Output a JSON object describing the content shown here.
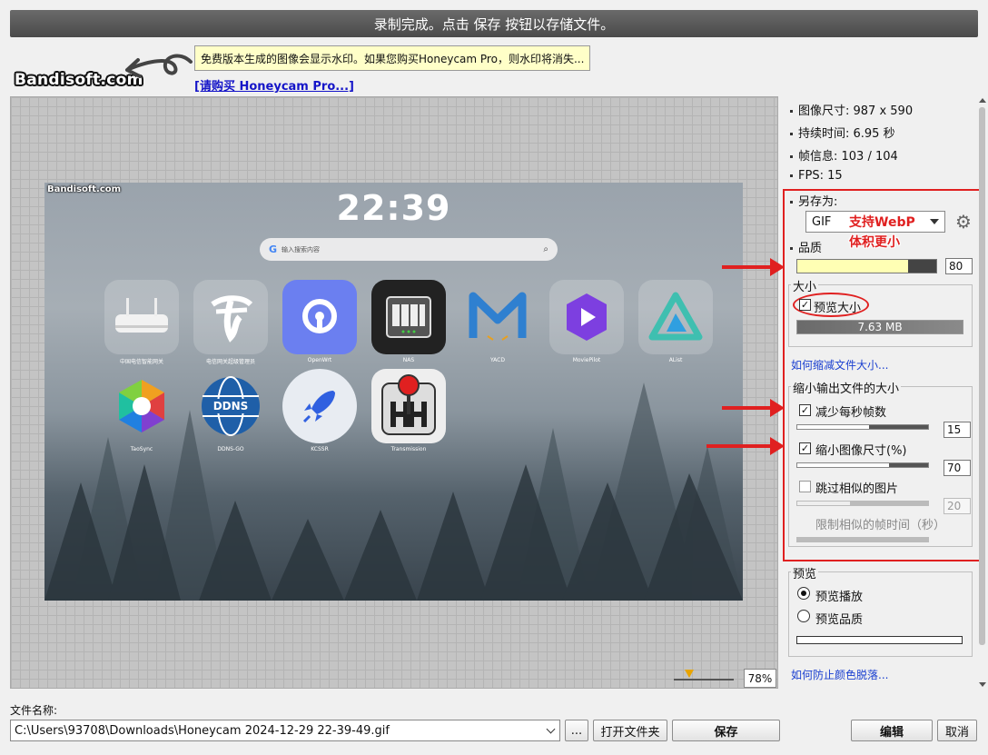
{
  "title_bar": "录制完成。点击 保存 按钮以存储文件。",
  "brand": "Bandisoft.com",
  "watermark_notice": "免费版本生成的图像会显示水印。如果您购买Honeycam Pro，则水印将消失...",
  "buy_link": "[请购买 Honeycam Pro...]",
  "preview": {
    "watermark": "Bandisoft.com",
    "clock": "22:39",
    "search_placeholder": "输入搜索内容",
    "apps": [
      {
        "label": "中国电信智能网关"
      },
      {
        "label": "电信网关超级管理员"
      },
      {
        "label": "OpenWrt"
      },
      {
        "label": "NAS"
      },
      {
        "label": "YACD"
      },
      {
        "label": "MoviePilot"
      },
      {
        "label": "AList"
      },
      {
        "label": "TaoSync"
      },
      {
        "label": "DDNS-GO"
      },
      {
        "label": "KCSSR"
      },
      {
        "label": "Transmission"
      }
    ],
    "ddns_text": "DDNS"
  },
  "zoom": "78%",
  "info": {
    "image_size": "图像尺寸: 987 x 590",
    "duration": "持续时间: 6.95 秒",
    "frames": "帧信息: 103 / 104",
    "fps": "FPS: 15"
  },
  "save_as": {
    "label": "另存为:",
    "format": "GIF",
    "annotation_line1": "支持WebP",
    "annotation_line2": "体积更小"
  },
  "quality": {
    "label": "品质",
    "value": "80",
    "fill_percent": 80
  },
  "size": {
    "group_title": "大小",
    "preview_size_label": "预览大小",
    "preview_size_checked": true,
    "file_size": "7.63 MB"
  },
  "reduce_link": "如何缩减文件大小...",
  "reduce": {
    "group_title": "缩小输出文件的大小",
    "fps_label": "减少每秒帧数",
    "fps_checked": true,
    "fps_value": "15",
    "fps_fill": 0.55,
    "scale_label": "缩小图像尺寸(%)",
    "scale_checked": true,
    "scale_value": "70",
    "scale_fill": 0.7,
    "skip_label": "跳过相似的图片",
    "skip_checked": false,
    "skip_value": "20",
    "skip_fill": 0.4,
    "limit_label": "限制相似的帧时间（秒）"
  },
  "preview_group": {
    "title": "预览",
    "play_label": "预览播放",
    "quality_label": "预览品质",
    "selected": "play"
  },
  "color_link": "如何防止颜色脱落...",
  "file_name_label": "文件名称:",
  "file_path": "C:\\Users\\93708\\Downloads\\Honeycam 2024-12-29 22-39-49.gif",
  "buttons": {
    "browse": "...",
    "open_folder": "打开文件夹",
    "save": "保存",
    "edit": "编辑",
    "cancel": "取消"
  },
  "colors": {
    "accent_red": "#e02020",
    "link_blue": "#1a3fd0",
    "quality_fill": "#ffffb4"
  }
}
